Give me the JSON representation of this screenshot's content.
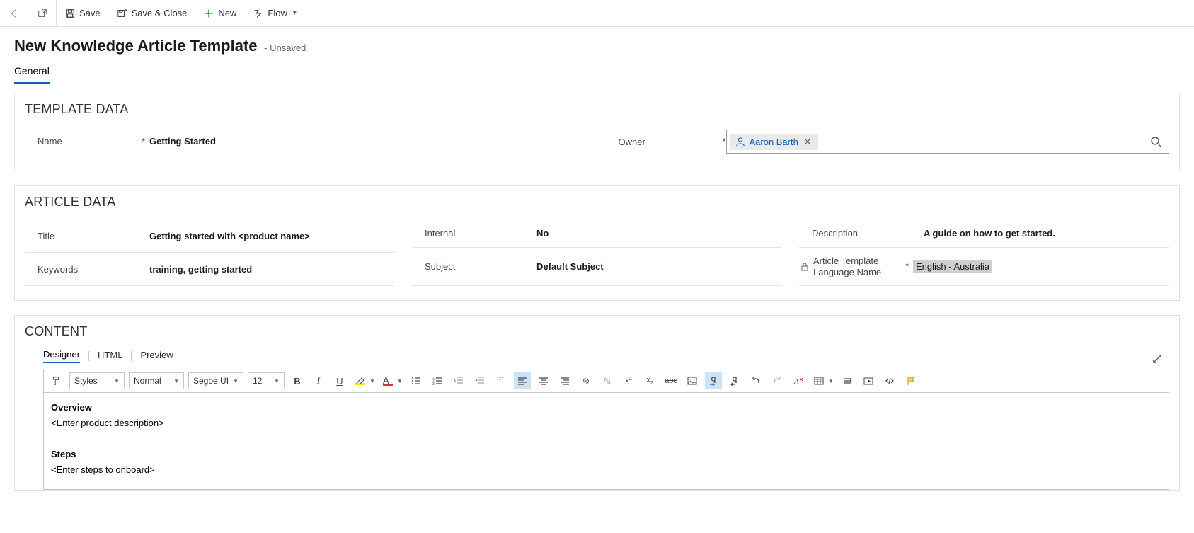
{
  "command_bar": {
    "save": "Save",
    "save_close": "Save & Close",
    "new": "New",
    "flow": "Flow"
  },
  "page": {
    "title": "New Knowledge Article Template",
    "status": "- Unsaved"
  },
  "form_tabs": {
    "general": "General"
  },
  "sections": {
    "template_data": "TEMPLATE DATA",
    "article_data": "ARTICLE DATA",
    "content": "CONTENT"
  },
  "template_data": {
    "name_label": "Name",
    "name_value": "Getting Started",
    "owner_label": "Owner",
    "owner_chip": "Aaron Barth"
  },
  "article_data": {
    "title_label": "Title",
    "title_value": "Getting started with <product name>",
    "keywords_label": "Keywords",
    "keywords_value": "training, getting started",
    "internal_label": "Internal",
    "internal_value": "No",
    "subject_label": "Subject",
    "subject_value": "Default Subject",
    "description_label": "Description",
    "description_value": "A guide on how to get started.",
    "lang_label": "Article Template Language Name",
    "lang_value": "English - Australia"
  },
  "content_tabs": {
    "designer": "Designer",
    "html": "HTML",
    "preview": "Preview"
  },
  "toolbar": {
    "styles": "Styles",
    "paragraph": "Normal",
    "font": "Segoe UI",
    "font_size": "12",
    "bold": "B",
    "italic": "I",
    "underline": "U",
    "font_color_glyph": "A",
    "quote_glyph": "”"
  },
  "content_body": {
    "h1": "Overview",
    "p1": "<Enter product description>",
    "h2": "Steps",
    "p2": "<Enter steps to onboard>"
  }
}
